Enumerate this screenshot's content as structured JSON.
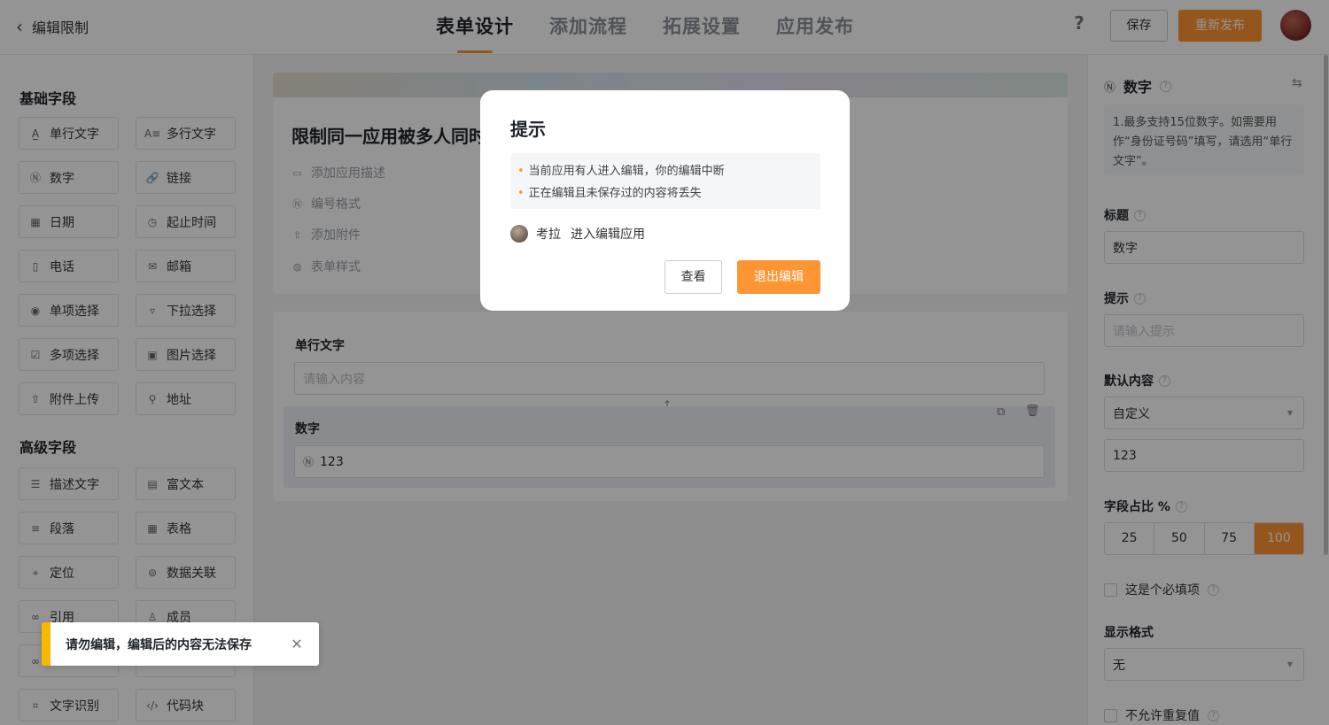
{
  "header": {
    "back_label": "编辑限制",
    "tabs": [
      "表单设计",
      "添加流程",
      "拓展设置",
      "应用发布"
    ],
    "help": "?",
    "save_label": "保存",
    "publish_label": "重新发布"
  },
  "left": {
    "basic_title": "基础字段",
    "advanced_title": "高级字段",
    "basic_fields": [
      {
        "label": "单行文字",
        "icon": "single-line-text-icon",
        "glyph": "A̲"
      },
      {
        "label": "多行文字",
        "icon": "multi-line-text-icon",
        "glyph": "A≡"
      },
      {
        "label": "数字",
        "icon": "number-icon",
        "glyph": "Ⓝ"
      },
      {
        "label": "链接",
        "icon": "link-icon",
        "glyph": "🔗"
      },
      {
        "label": "日期",
        "icon": "calendar-icon",
        "glyph": "▦"
      },
      {
        "label": "起止时间",
        "icon": "time-range-icon",
        "glyph": "◷"
      },
      {
        "label": "电话",
        "icon": "phone-icon",
        "glyph": "▯"
      },
      {
        "label": "邮箱",
        "icon": "mail-icon",
        "glyph": "✉"
      },
      {
        "label": "单项选择",
        "icon": "radio-icon",
        "glyph": "◉"
      },
      {
        "label": "下拉选择",
        "icon": "dropdown-icon",
        "glyph": "▿"
      },
      {
        "label": "多项选择",
        "icon": "checkbox-icon",
        "glyph": "☑"
      },
      {
        "label": "图片选择",
        "icon": "image-icon",
        "glyph": "▣"
      },
      {
        "label": "附件上传",
        "icon": "upload-icon",
        "glyph": "⇧"
      },
      {
        "label": "地址",
        "icon": "location-icon",
        "glyph": "⚲"
      }
    ],
    "advanced_fields": [
      {
        "label": "描述文字",
        "icon": "description-icon",
        "glyph": "☰"
      },
      {
        "label": "富文本",
        "icon": "rich-text-icon",
        "glyph": "▤"
      },
      {
        "label": "段落",
        "icon": "paragraph-icon",
        "glyph": "≡"
      },
      {
        "label": "表格",
        "icon": "table-icon",
        "glyph": "▦"
      },
      {
        "label": "定位",
        "icon": "locate-icon",
        "glyph": "⌖"
      },
      {
        "label": "数据关联",
        "icon": "data-link-icon",
        "glyph": "⊚"
      },
      {
        "label": "引用",
        "icon": "reference-icon",
        "glyph": "∞"
      },
      {
        "label": "成员",
        "icon": "member-icon",
        "glyph": "♙"
      },
      {
        "label": "",
        "icon": "hidden-field-icon",
        "glyph": "∞"
      },
      {
        "label": "",
        "icon": "hidden-field-icon",
        "glyph": ""
      },
      {
        "label": "文字识别",
        "icon": "ocr-icon",
        "glyph": "⌗"
      },
      {
        "label": "代码块",
        "icon": "code-icon",
        "glyph": "‹/›"
      }
    ]
  },
  "form": {
    "title": "限制同一应用被多人同时编辑",
    "meta": [
      {
        "label": "添加应用描述",
        "icon": "comment-icon",
        "glyph": "▭"
      },
      {
        "label": "编号格式",
        "icon": "number-format-icon",
        "glyph": "Ⓝ"
      },
      {
        "label": "添加附件",
        "icon": "attachment-icon",
        "glyph": "⇧"
      },
      {
        "label": "表单样式",
        "icon": "palette-icon",
        "glyph": "◍"
      }
    ],
    "field1_label": "单行文字",
    "field1_placeholder": "请输入内容",
    "field2_label": "数字",
    "field2_value": "123",
    "field2_prefix": "Ⓝ"
  },
  "right": {
    "field_type": "数字",
    "note": "1.最多支持15位数字。如需要用作“身份证号码”填写，请选用“单行文字”。",
    "title_label": "标题",
    "title_value": "数字",
    "hint_label": "提示",
    "hint_placeholder": "请输入提示",
    "default_label": "默认内容",
    "default_select": "自定义",
    "default_value": "123",
    "width_label": "字段占比 %",
    "width_options": [
      "25",
      "50",
      "75",
      "100"
    ],
    "required_label": "这是个必填项",
    "format_label": "显示格式",
    "format_select": "无",
    "unique_label": "不允许重复值"
  },
  "modal": {
    "title": "提示",
    "items": [
      "当前应用有人进入编辑，你的编辑中断",
      "正在编辑且未保存过的内容将丢失"
    ],
    "user_name": "考拉",
    "user_action": "进入编辑应用",
    "view_label": "查看",
    "exit_label": "退出编辑"
  },
  "toast": {
    "message": "请勿编辑，编辑后的内容无法保存",
    "close": "✕"
  }
}
